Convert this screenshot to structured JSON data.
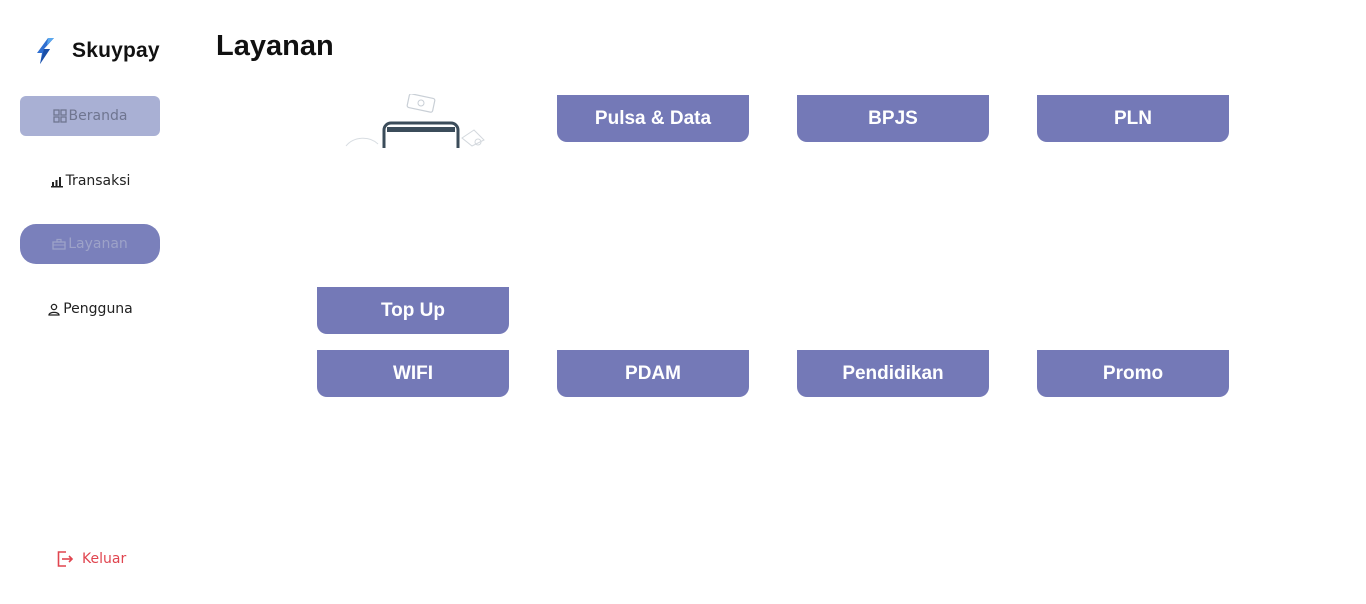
{
  "app": {
    "brand": "Skuypay"
  },
  "sidebar": {
    "items": [
      {
        "label": "Beranda",
        "icon": "grid-icon"
      },
      {
        "label": "Transaksi",
        "icon": "bar-chart-icon"
      },
      {
        "label": "Layanan",
        "icon": "briefcase-icon"
      },
      {
        "label": "Pengguna",
        "icon": "user-icon"
      }
    ],
    "logout": {
      "label": "Keluar",
      "icon": "logout-icon"
    }
  },
  "page": {
    "title": "Layanan"
  },
  "services": {
    "pulsa": "Pulsa & Data",
    "bpjs": "BPJS",
    "pln": "PLN",
    "topup": "Top Up",
    "wifi": "WIFI",
    "pdam": "PDAM",
    "pendidikan": "Pendidikan",
    "promo": "Promo"
  },
  "colors": {
    "accent": "#7479b7",
    "nav_active": "#a9b0d4",
    "logout": "#e0454f"
  }
}
